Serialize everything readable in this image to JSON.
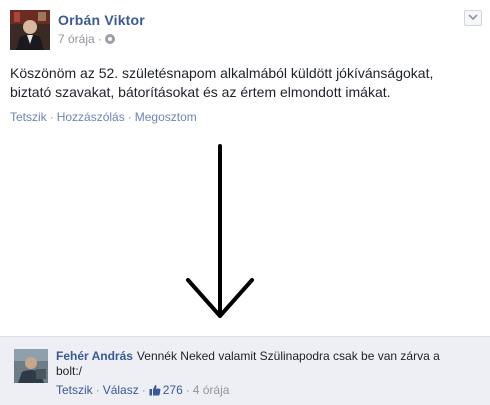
{
  "post": {
    "author": "Orbán Viktor",
    "time": "7 órája",
    "time_separator": "·",
    "text_line1": "Köszönöm az 52. születésnapom alkalmából küldött jókívánságokat,",
    "text_line2": "biztató szavakat, bátorításokat és az értem elmondott imákat.",
    "actions": {
      "like": "Tetszik",
      "comment": "Hozzászólás",
      "share": "Megosztom",
      "separator": "·"
    },
    "icons": {
      "globe": "globe-icon",
      "chevron": "chevron-down-icon"
    }
  },
  "comment": {
    "author": "Fehér András",
    "text": "Vennék Neked valamit Szülinapodra csak be van zárva a bolt:/",
    "actions": {
      "like": "Tetszik",
      "reply": "Válasz",
      "like_count": "276",
      "time": "4 órája",
      "separator": "·"
    },
    "icons": {
      "like": "thumbs-up-icon"
    }
  },
  "colors": {
    "link_blue": "#3b5998",
    "action_blue": "#6d84b4",
    "meta_gray": "#90949c",
    "comment_bg": "#edeff4"
  }
}
